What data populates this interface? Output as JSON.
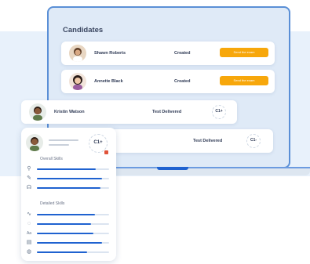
{
  "page": {
    "title": "Candidates"
  },
  "candidates": [
    {
      "name": "Shawn Roberts",
      "status": "Created",
      "action": "Send the exam"
    },
    {
      "name": "Annette Black",
      "status": "Created",
      "action": "Send the exam"
    },
    {
      "name": "Kristin Watson",
      "status": "Test Delivered",
      "level": "C1+"
    },
    {
      "name": "",
      "status": "Test Delivered",
      "level": "C1-"
    }
  ],
  "skill_card": {
    "level": "C1+",
    "overall_title": "Overall Skills",
    "detailed_title": "Detailed Skills",
    "overall": [
      {
        "icon": "microphone-icon",
        "glyph": "⚲",
        "value": 0.82
      },
      {
        "icon": "pencil-icon",
        "glyph": "✎",
        "value": 0.9
      },
      {
        "icon": "headphones-icon",
        "glyph": "☊",
        "value": 0.88
      }
    ],
    "detailed": [
      {
        "icon": "pronunciation-icon",
        "glyph": "∿",
        "value": 0.8
      },
      {
        "icon": "speech-icon",
        "glyph": "◌",
        "value": 0.75
      },
      {
        "icon": "font-size-icon",
        "glyph": "Aa",
        "value": 0.78
      },
      {
        "icon": "book-icon",
        "glyph": "▤",
        "value": 0.9
      },
      {
        "icon": "lightbulb-icon",
        "glyph": "◍",
        "value": 0.7
      }
    ]
  },
  "colors": {
    "accent": "#1f62d0",
    "button": "#f7a70b",
    "panel": "#dfeaf7"
  }
}
